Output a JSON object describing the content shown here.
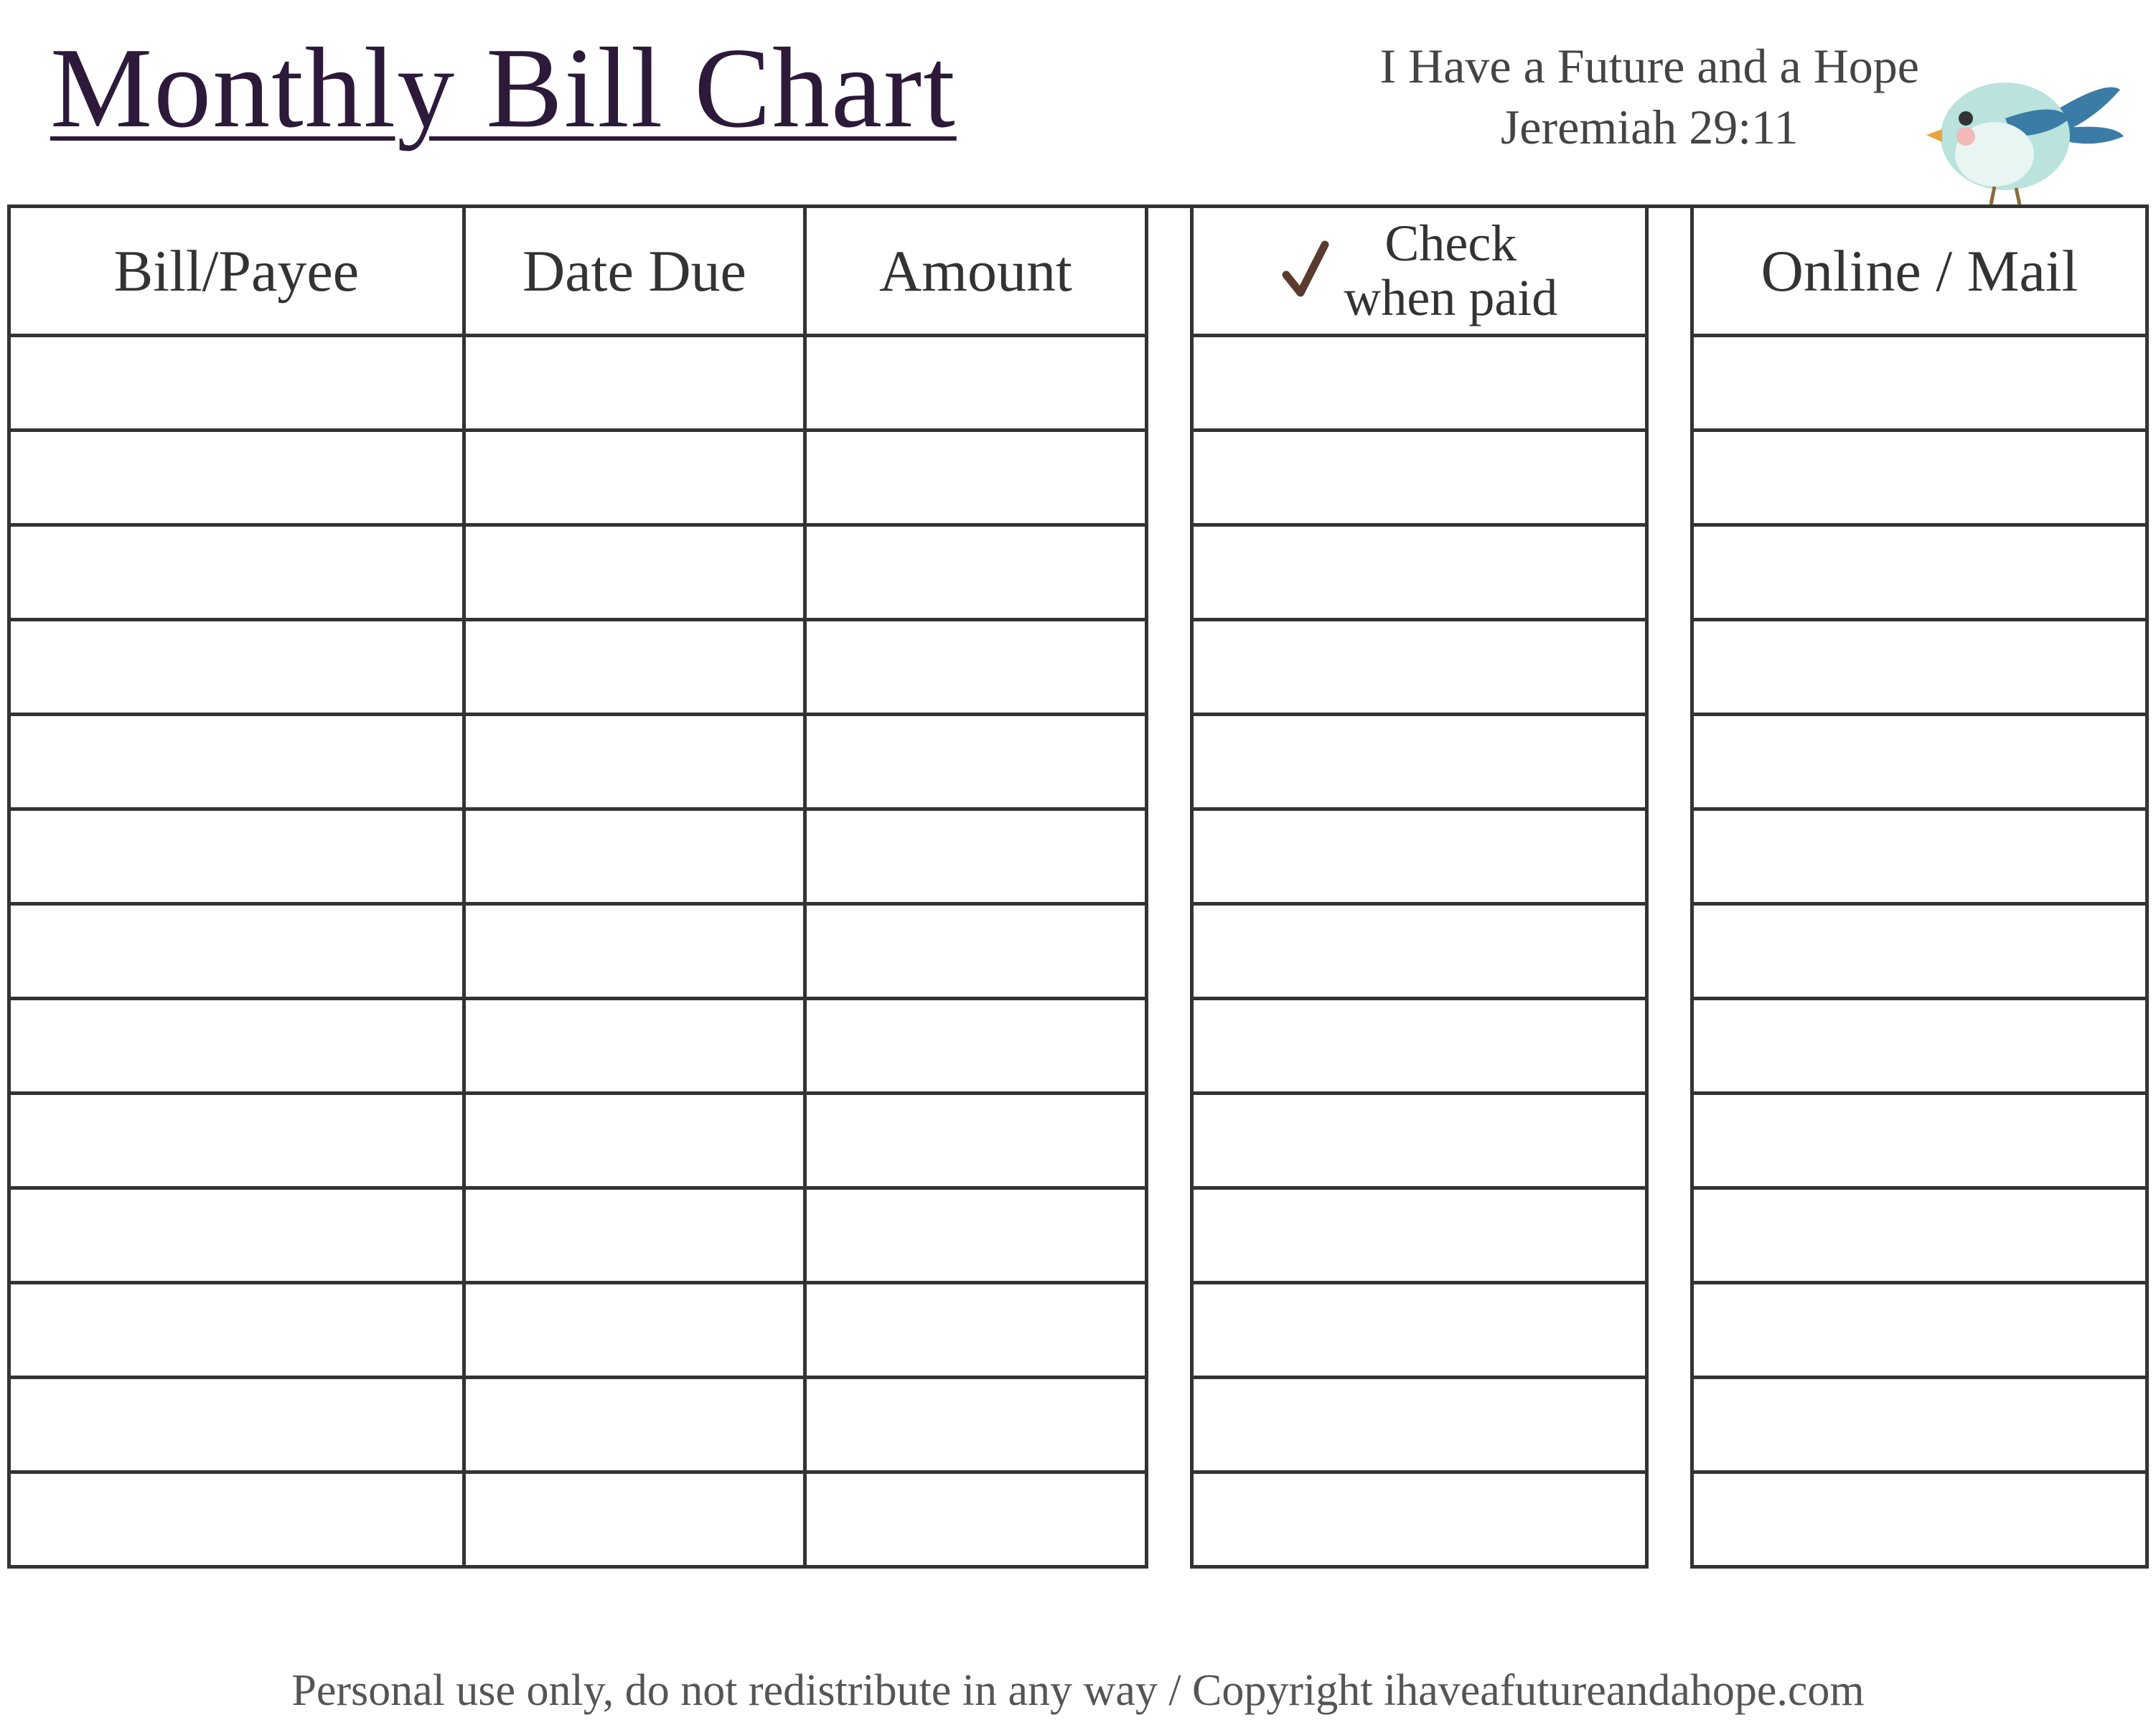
{
  "title": "Monthly Bill Chart",
  "verse_line1": "I Have a Future and a Hope",
  "verse_line2": "Jeremiah 29:11",
  "columns": {
    "payee": "Bill/Payee",
    "date_due": "Date Due",
    "amount": "Amount",
    "check_line1": "Check",
    "check_line2": "when paid",
    "online_mail": "Online / Mail"
  },
  "row_count": 13,
  "footer": "Personal use only, do not redistribute in any way / Copyright ihaveafutureandahope.com",
  "chart_data": {
    "type": "table",
    "title": "Monthly Bill Chart",
    "columns": [
      "Bill/Payee",
      "Date Due",
      "Amount",
      "Check when paid",
      "Online / Mail"
    ],
    "rows": [
      [
        "",
        "",
        "",
        "",
        ""
      ],
      [
        "",
        "",
        "",
        "",
        ""
      ],
      [
        "",
        "",
        "",
        "",
        ""
      ],
      [
        "",
        "",
        "",
        "",
        ""
      ],
      [
        "",
        "",
        "",
        "",
        ""
      ],
      [
        "",
        "",
        "",
        "",
        ""
      ],
      [
        "",
        "",
        "",
        "",
        ""
      ],
      [
        "",
        "",
        "",
        "",
        ""
      ],
      [
        "",
        "",
        "",
        "",
        ""
      ],
      [
        "",
        "",
        "",
        "",
        ""
      ],
      [
        "",
        "",
        "",
        "",
        ""
      ],
      [
        "",
        "",
        "",
        "",
        ""
      ],
      [
        "",
        "",
        "",
        "",
        ""
      ]
    ]
  }
}
